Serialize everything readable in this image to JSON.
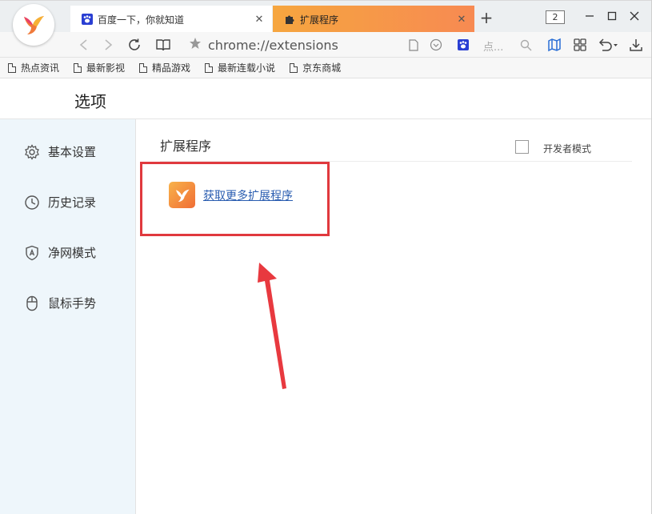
{
  "tabs": [
    {
      "title": "百度一下，你就知道",
      "favicon": "baidu-paw-icon"
    },
    {
      "title": "扩展程序",
      "favicon": "puzzle-icon"
    }
  ],
  "window": {
    "count": "2"
  },
  "address": {
    "url": "chrome://extensions",
    "search_hint": "点..."
  },
  "bookmarks": [
    "热点资讯",
    "最新影视",
    "精品游戏",
    "最新连载小说",
    "京东商城"
  ],
  "page": {
    "title": "选项"
  },
  "sidebar": {
    "items": [
      {
        "label": "基本设置",
        "icon": "gear-icon"
      },
      {
        "label": "历史记录",
        "icon": "clock-icon"
      },
      {
        "label": "净网模式",
        "icon": "shield-icon"
      },
      {
        "label": "鼠标手势",
        "icon": "mouse-icon"
      }
    ]
  },
  "main": {
    "title": "扩展程序",
    "developer_mode_label": "开发者模式",
    "get_more_link": "获取更多扩展程序"
  },
  "colors": {
    "accent_tab": "#f79a48",
    "highlight": "#e0393e",
    "link": "#2a5db0"
  }
}
